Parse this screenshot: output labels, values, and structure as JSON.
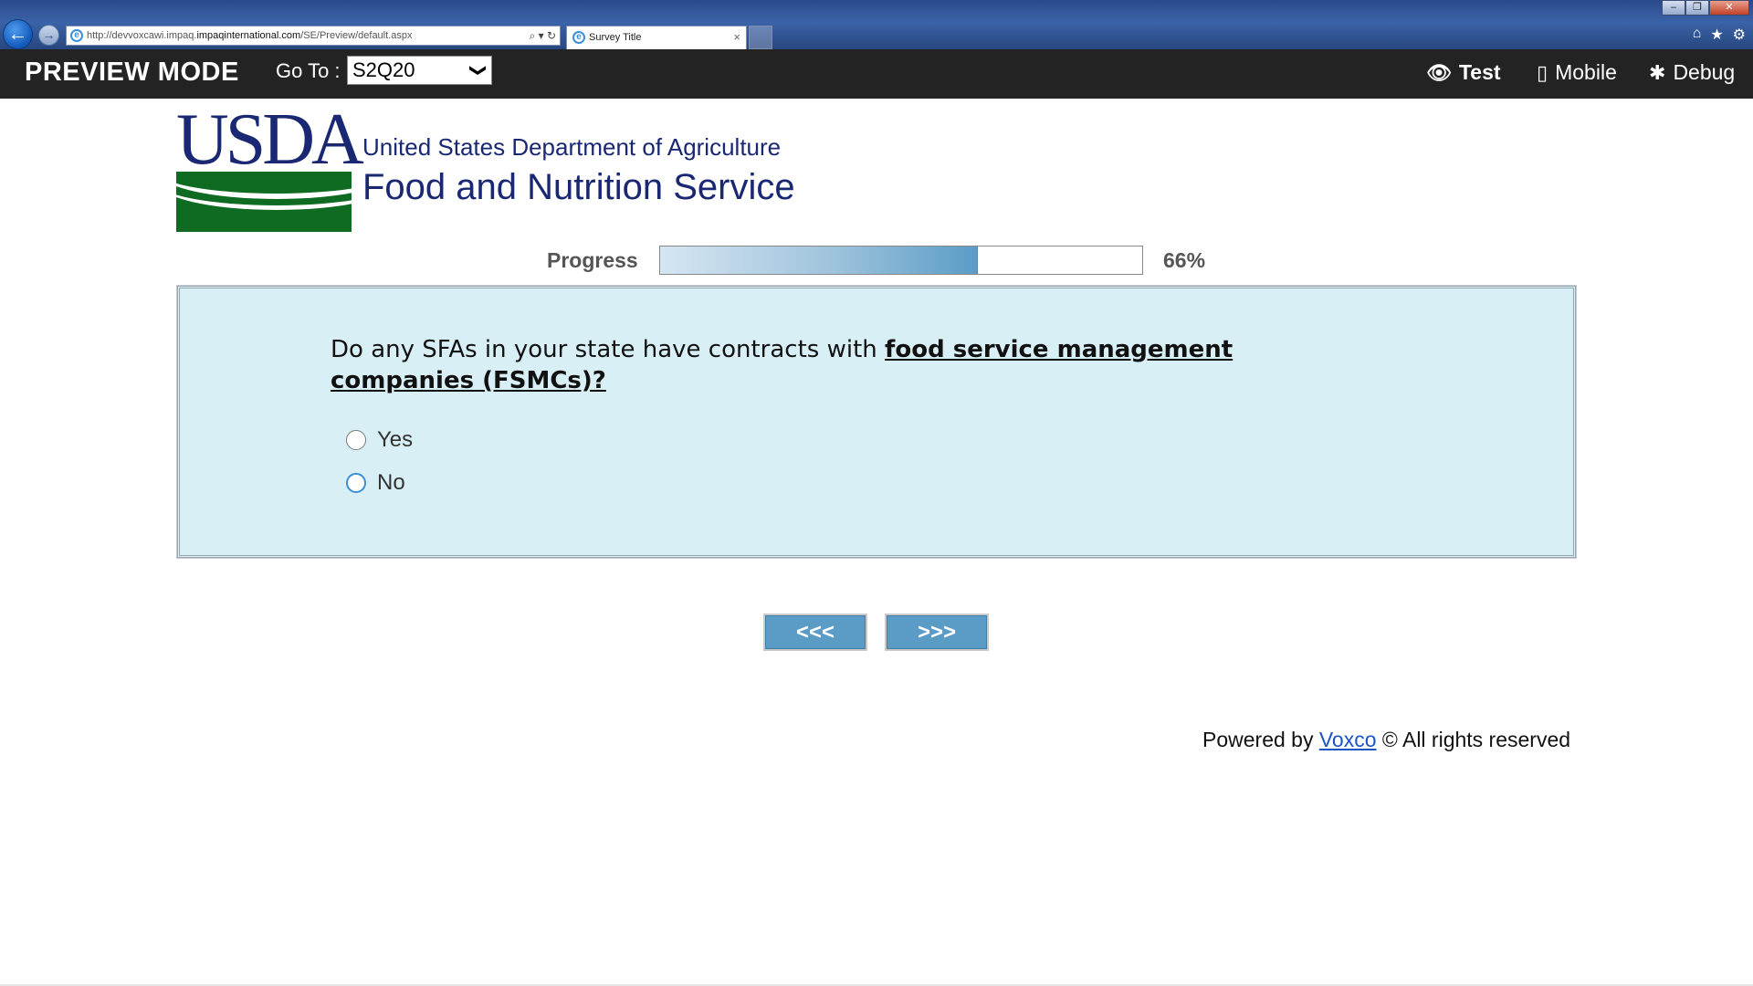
{
  "browser": {
    "url_prefix": "http://devvoxcawi.impaq.",
    "url_host": "impaqinternational.com",
    "url_path": "/SE/Preview/default.aspx",
    "tab_title": "Survey Title",
    "tab_close": "×",
    "back_glyph": "←",
    "forward_glyph": "→",
    "address_tools": "⌕ ▾ ↻",
    "win_minimize": "–",
    "win_restore": "❐",
    "win_close": "✕",
    "home_icon": "⌂",
    "favorites_icon": "★",
    "tools_icon": "⚙"
  },
  "toolbar": {
    "title": "PREVIEW MODE",
    "goto_label": "Go To :",
    "goto_value": "S2Q20",
    "goto_chevron": "❯",
    "modes": {
      "test": "Test",
      "mobile": "Mobile",
      "debug": "Debug"
    },
    "icons": {
      "test": "eye-icon",
      "mobile": "phone-icon",
      "debug": "bug-icon"
    },
    "icon_glyphs": {
      "test": "👁",
      "mobile": "▯",
      "debug": "✱"
    }
  },
  "logo": {
    "usda_letters": "USDA",
    "line1": "United States Department of Agriculture",
    "line2": "Food and Nutrition Service",
    "green": "#0f6a22",
    "navy": "#1a2773"
  },
  "progress": {
    "label": "Progress",
    "value_text": "66%",
    "fraction": 0.66
  },
  "question": {
    "prefix": "Do any SFAs in your state have contracts with ",
    "emphasis": "food service management companies (FSMCs)?",
    "options": [
      {
        "label": "Yes"
      },
      {
        "label": "No"
      }
    ],
    "panel_bg": "#d9eff6"
  },
  "navigation": {
    "prev_label": "<<<",
    "next_label": ">>>",
    "button_color": "#5b9cc7"
  },
  "footer": {
    "prefix": "Powered by ",
    "link": "Voxco",
    "suffix": " © All rights reserved"
  }
}
